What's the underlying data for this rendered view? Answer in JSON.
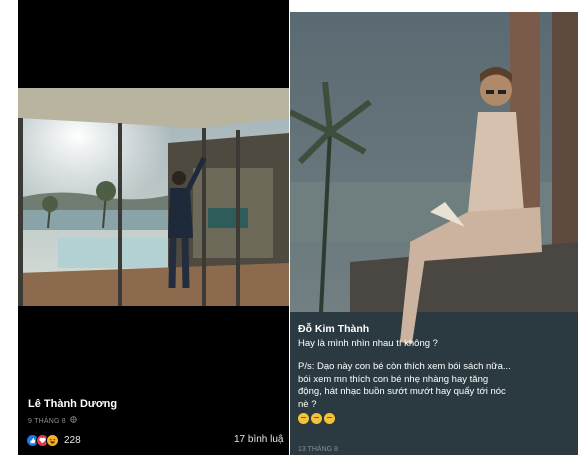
{
  "left_post": {
    "author": "Lê Thành Dương",
    "date": "9 THÁNG 8",
    "reaction_count": "228",
    "comments": "17 bình luậ",
    "reaction_icons": [
      "like-icon",
      "love-icon",
      "haha-icon"
    ]
  },
  "right_post": {
    "author": "Đỗ Kim Thành",
    "line1": "Hay là mình nhìn nhau tí không ?",
    "line2": "P/s: Dạo này con bé còn thích xem bói sách nữa...",
    "line3": "bói xem mn thích con bé nhẹ nhàng hay tăng",
    "line4": "động, hát nhạc buồn sướt mướt hay quẩy tới nóc",
    "line5": "nè ?",
    "emoji_icons": [
      "thinking-emoji",
      "thinking-emoji",
      "thinking-emoji"
    ],
    "date": "13 THÁNG 8"
  },
  "colors": {
    "background": "#000000",
    "text": "#ffffff",
    "meta": "#8a8d91",
    "like": "#1877f2",
    "love": "#e8364f",
    "haha": "#f7b125"
  }
}
